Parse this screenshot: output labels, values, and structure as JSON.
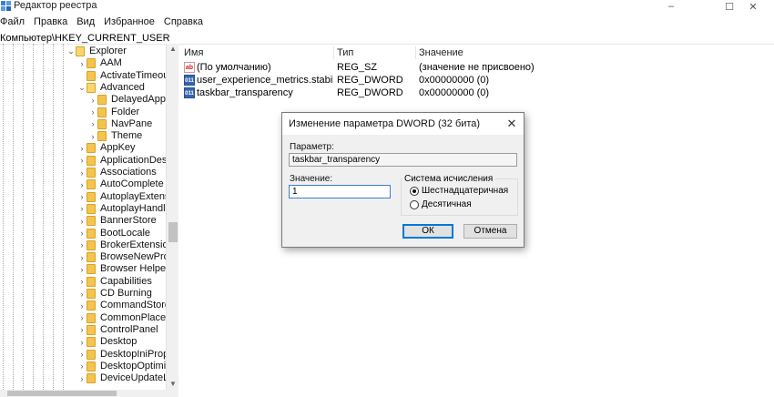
{
  "window": {
    "title": "Редактор реестра",
    "controls": {
      "minimize": "–",
      "maximize": "☐",
      "close": "✕"
    }
  },
  "menu": [
    "Файл",
    "Правка",
    "Вид",
    "Избранное",
    "Справка"
  ],
  "address": "Компьютер\\HKEY_CURRENT_USER",
  "tree": [
    {
      "label": "Explorer",
      "chev": "⌄",
      "open": true
    },
    {
      "label": "AAM",
      "chev": "›"
    },
    {
      "label": "ActivateTimeout",
      "chev": ""
    },
    {
      "label": "Advanced",
      "chev": "⌄",
      "open": true
    },
    {
      "label": "DelayedApps",
      "chev": "›"
    },
    {
      "label": "Folder",
      "chev": "›"
    },
    {
      "label": "NavPane",
      "chev": "›"
    },
    {
      "label": "Theme",
      "chev": "›"
    },
    {
      "label": "AppKey",
      "chev": "›"
    },
    {
      "label": "ApplicationDestin",
      "chev": "›"
    },
    {
      "label": "Associations",
      "chev": "›"
    },
    {
      "label": "AutoComplete",
      "chev": "›"
    },
    {
      "label": "AutoplayExtension",
      "chev": "›"
    },
    {
      "label": "AutoplayHandlers",
      "chev": "›"
    },
    {
      "label": "BannerStore",
      "chev": "›"
    },
    {
      "label": "BootLocale",
      "chev": "›"
    },
    {
      "label": "BrokerExtensions",
      "chev": "›"
    },
    {
      "label": "BrowseNewProces",
      "chev": "›"
    },
    {
      "label": "Browser Helper O",
      "chev": "›"
    },
    {
      "label": "Capabilities",
      "chev": "›"
    },
    {
      "label": "CD Burning",
      "chev": "›"
    },
    {
      "label": "CommandStore",
      "chev": "›"
    },
    {
      "label": "CommonPlaces",
      "chev": "›"
    },
    {
      "label": "ControlPanel",
      "chev": "›"
    },
    {
      "label": "Desktop",
      "chev": "›"
    },
    {
      "label": "DesktopIniPropert",
      "chev": "›"
    },
    {
      "label": "DesktopOptimizat",
      "chev": "›"
    },
    {
      "label": "DeviceUpdateLoc",
      "chev": "›"
    }
  ],
  "list": {
    "columns": {
      "name": "Имя",
      "type": "Тип",
      "value": "Значение"
    },
    "rows": [
      {
        "icon": "ab",
        "name": "(По умолчанию)",
        "type": "REG_SZ",
        "value": "(значение не присвоено)"
      },
      {
        "icon": "011",
        "name": "user_experience_metrics.stability.exi...",
        "type": "REG_DWORD",
        "value": "0x00000000 (0)"
      },
      {
        "icon": "011",
        "name": "taskbar_transparency",
        "type": "REG_DWORD",
        "value": "0x00000000 (0)"
      }
    ]
  },
  "dialog": {
    "title": "Изменение параметра DWORD (32 бита)",
    "close": "✕",
    "param_label": "Параметр:",
    "param_value": "taskbar_transparency",
    "value_label": "Значение:",
    "value": "1",
    "base_label": "Система исчисления",
    "radio_hex": "Шестнадцатеричная",
    "radio_dec": "Десятичная",
    "ok": "ОК",
    "cancel": "Отмена"
  }
}
